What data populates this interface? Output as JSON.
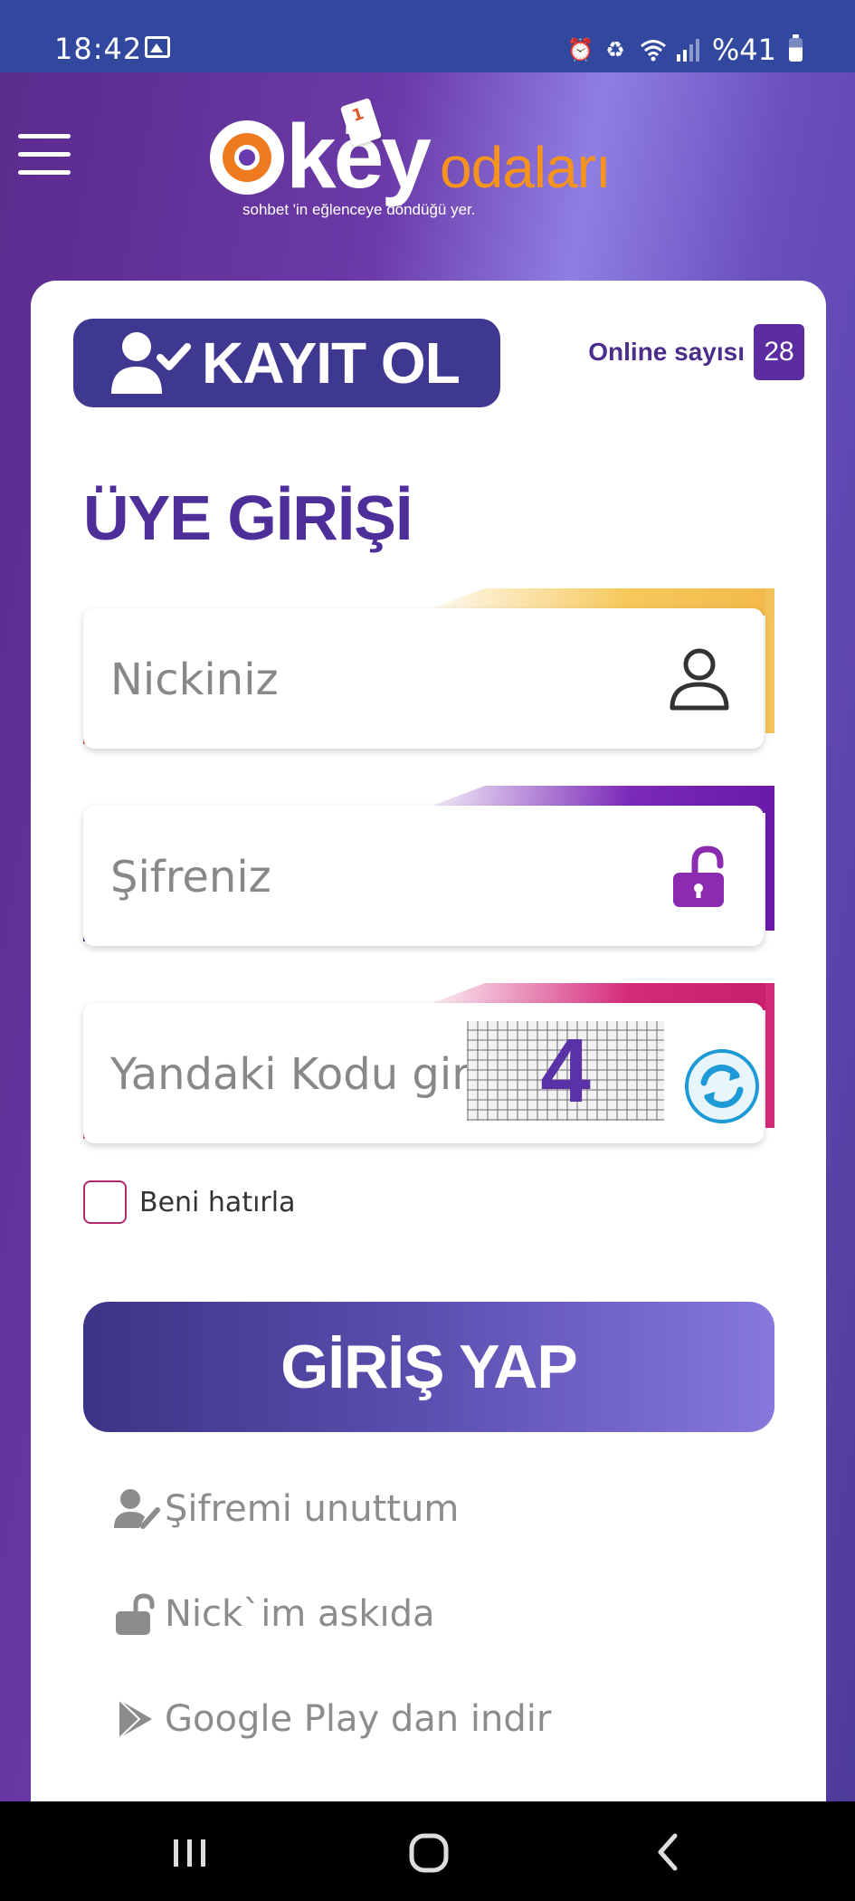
{
  "status_bar": {
    "time": "18:42",
    "battery": "%41"
  },
  "header": {
    "logo_main": "okey",
    "logo_sub": "odaları",
    "logo_slogan": "sohbet 'in eğlenceye  döndüğü yer."
  },
  "card": {
    "register_label": "KAYIT OL",
    "online_label": "Online sayısı",
    "online_count": "28",
    "login_title": "ÜYE GİRİŞİ",
    "nick_placeholder": "Nickiniz",
    "password_placeholder": "Şifreniz",
    "captcha_placeholder": "Yandaki Kodu giri",
    "captcha_code": "4",
    "remember_label": "Beni hatırla",
    "login_button": "GİRİŞ YAP",
    "links": {
      "forgot_password": "Şifremi unuttum",
      "nick_suspended": "Nick`im askıda",
      "google_play": "Google Play dan indir"
    }
  },
  "colors": {
    "status_bar": "#31489e",
    "brand_purple": "#3f3890",
    "title_purple": "#4e2f9a",
    "logo_orange": "#f6921e",
    "nick_accent": "#e0481c",
    "password_accent": "#6a1aa8",
    "captcha_accent": "#d42a7a",
    "link_gray": "#8c8c8c"
  },
  "icons": {
    "register": "user-check-icon",
    "nick": "user-icon",
    "password": "unlock-icon",
    "refresh": "refresh-icon",
    "forgot": "user-edit-icon",
    "suspended": "unlock-icon",
    "play": "google-play-icon"
  }
}
